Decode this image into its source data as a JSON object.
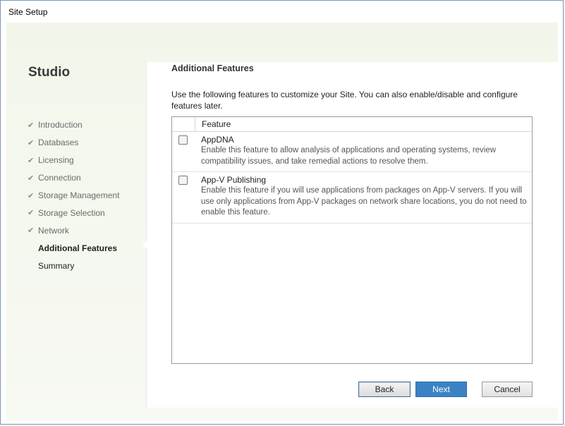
{
  "window": {
    "title": "Site Setup"
  },
  "sidebar": {
    "title": "Studio",
    "items": [
      {
        "label": "Introduction",
        "state": "done"
      },
      {
        "label": "Databases",
        "state": "done"
      },
      {
        "label": "Licensing",
        "state": "done"
      },
      {
        "label": "Connection",
        "state": "done"
      },
      {
        "label": "Storage Management",
        "state": "done"
      },
      {
        "label": "Storage Selection",
        "state": "done"
      },
      {
        "label": "Network",
        "state": "done"
      },
      {
        "label": "Additional Features",
        "state": "active"
      },
      {
        "label": "Summary",
        "state": "pending"
      }
    ],
    "check_glyph": "✔"
  },
  "main": {
    "heading": "Additional Features",
    "description": "Use the following features to customize your Site.  You can also enable/disable and configure features later.",
    "table": {
      "column_header": "Feature",
      "rows": [
        {
          "name": "AppDNA",
          "checked": false,
          "description": "Enable this feature to allow analysis of applications and operating systems, review compatibility issues, and take remedial actions to resolve them."
        },
        {
          "name": "App-V Publishing",
          "checked": false,
          "description": "Enable this feature if you will use applications from packages on App-V servers. If you will use only applications from App-V packages on network share locations, you do not need to enable this feature."
        }
      ]
    }
  },
  "buttons": {
    "back": "Back",
    "next": "Next",
    "cancel": "Cancel"
  },
  "colors": {
    "accent": "#3b82c4",
    "panel_bg": "#f2f6ea"
  }
}
